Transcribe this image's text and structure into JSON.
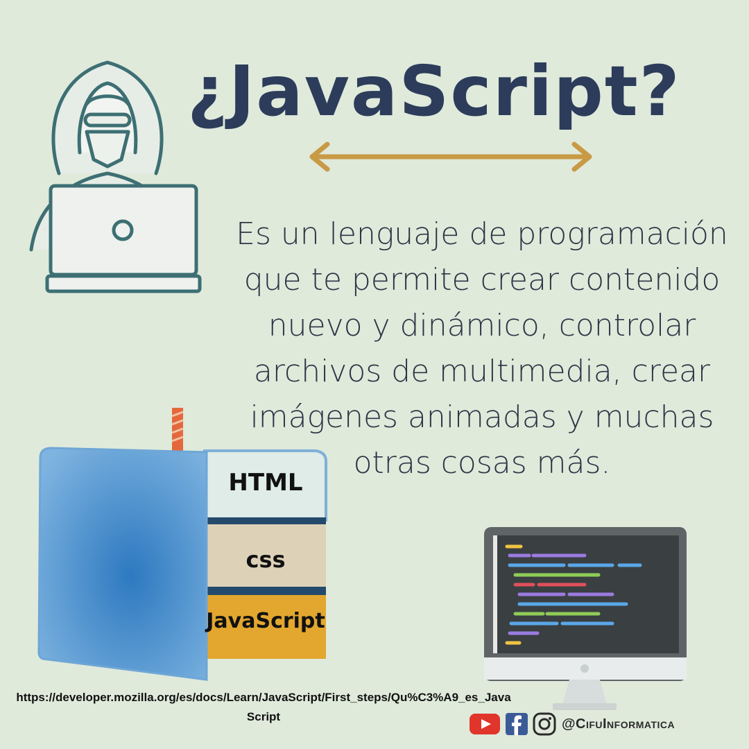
{
  "title": "¿JavaScript?",
  "description": "Es un lenguaje de programación que te permite crear contenido nuevo y dinámico, controlar archivos de multimedia, crear imágenes animadas y muchas otras cosas más.",
  "stack_layers": {
    "html": "HTML",
    "css": "css",
    "javascript": "JavaScript"
  },
  "source_url": "https://developer.mozilla.org/es/docs/Learn/JavaScript/First_steps/Qu%C3%A9_es_JavaScript",
  "social": {
    "handle": "@CifuInformatica",
    "icons": [
      "youtube-icon",
      "facebook-icon",
      "instagram-icon"
    ]
  },
  "colors": {
    "background": "#dfeadb",
    "title": "#2c3c5a",
    "arrow": "#c99a45",
    "hacker_outline": "#3d6f73",
    "cake_blue": "#3a86c8",
    "js_layer": "#e3a72f"
  }
}
